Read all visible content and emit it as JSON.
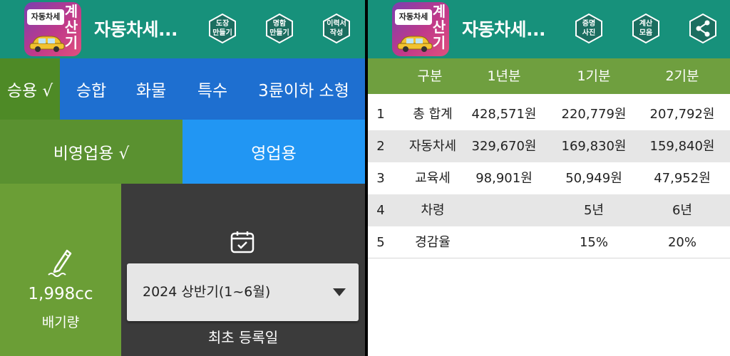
{
  "app": {
    "title": "자동차세...",
    "logo_plate": "자동차세",
    "logo_vertical": "계산기"
  },
  "left": {
    "toolbar": {
      "btn1": "도장\n만들기",
      "btn2": "명함\n만들기",
      "btn3": "이력서\n작성"
    },
    "categories": [
      {
        "label": "승용 √"
      },
      {
        "label": "승합"
      },
      {
        "label": "화물"
      },
      {
        "label": "특수"
      },
      {
        "label": "3륜이하 소형"
      }
    ],
    "usage": [
      {
        "label": "비영업용 √"
      },
      {
        "label": "영업용"
      }
    ],
    "displacement": {
      "value": "1,998cc",
      "label": "배기량"
    },
    "period_select": {
      "value": "2024 상반기(1~6월)"
    },
    "first_registration_label": "최초 등록일"
  },
  "right": {
    "toolbar": {
      "btn1": "증명\n사진",
      "btn2": "계산\n모음"
    },
    "table": {
      "headers": [
        "구분",
        "1년분",
        "1기분",
        "2기분"
      ],
      "rows": [
        {
          "no": "1",
          "name": "총 합계",
          "year": "428,571원",
          "p1": "220,779원",
          "p2": "207,792원"
        },
        {
          "no": "2",
          "name": "자동차세",
          "year": "329,670원",
          "p1": "169,830원",
          "p2": "159,840원"
        },
        {
          "no": "3",
          "name": "교육세",
          "year": "98,901원",
          "p1": "50,949원",
          "p2": "47,952원"
        },
        {
          "no": "4",
          "name": "차령",
          "year": "",
          "p1": "5년",
          "p2": "6년"
        },
        {
          "no": "5",
          "name": "경감율",
          "year": "",
          "p1": "15%",
          "p2": "20%"
        }
      ]
    }
  },
  "colors": {
    "appbar": "#17917b",
    "selected_green": "#4e8a26",
    "tab_blue": "#1e6fd0",
    "light_blue": "#2196f3",
    "light_green": "#6b9e36",
    "header_green": "#6f9f3f"
  }
}
